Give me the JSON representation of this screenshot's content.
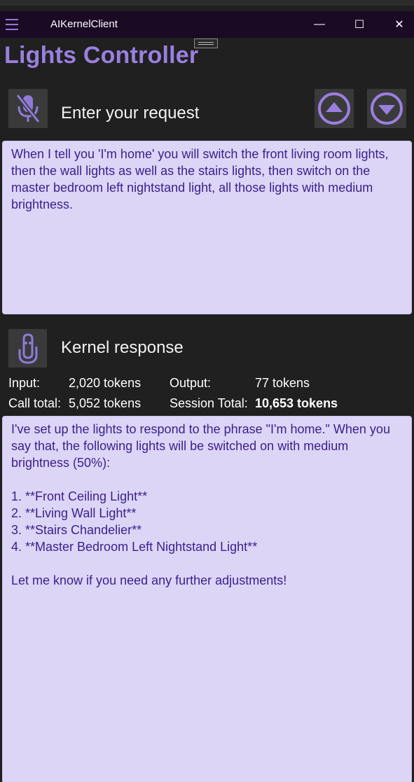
{
  "window": {
    "title": "AIKernelClient",
    "minimize_glyph": "—",
    "maximize_glyph": "☐",
    "close_glyph": "✕"
  },
  "app": {
    "title": "Lights Controller"
  },
  "request": {
    "label": "Enter your request",
    "text": "When I tell you 'I'm home' you will switch the front living room lights, then the wall lights as well as the stairs lights, then switch on the master bedroom left nightstand light, all those lights with medium brightness."
  },
  "response": {
    "label": "Kernel response",
    "text": "I've set up the lights to respond to the phrase \"I'm home.\" When you say that, the following lights will be switched on with medium brightness (50%):\n\n1. **Front Ceiling Light**\n2. **Living Wall Light**\n3. **Stairs Chandelier**\n4. **Master Bedroom Left Nightstand Light**\n\nLet me know if you need any further adjustments!"
  },
  "stats": {
    "input_label": "Input:",
    "input_value": "2,020 tokens",
    "output_label": "Output:",
    "output_value": "77 tokens",
    "call_total_label": "Call total:",
    "call_total_value": "5,052 tokens",
    "session_total_label": "Session Total:",
    "session_total_value": "10,653 tokens"
  },
  "colors": {
    "accent": "#9a7fe0",
    "textbox_bg": "#ddd5f6",
    "textbox_text": "#3a1e8c",
    "titlebar_bg": "#1a0a24"
  },
  "icons": {
    "menu": "hamburger-icon",
    "mic": "microphone-off-icon",
    "up": "arrow-up-circle-icon",
    "down": "arrow-down-circle-icon",
    "response": "clippy-icon"
  }
}
